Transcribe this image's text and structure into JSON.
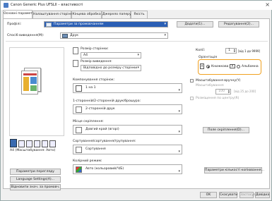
{
  "window": {
    "title": "Canon Generic Plus UFSLII – властивості",
    "close": "×"
  },
  "tabs": [
    {
      "label": "Основні параметри"
    },
    {
      "label": "Налаштування сторінки"
    },
    {
      "label": "Кінцева обробка"
    },
    {
      "label": "Джерело паперу"
    },
    {
      "label": "Якість"
    }
  ],
  "profile": {
    "label": "Профілі:",
    "value": "Параметри за промовчанням",
    "add_label": "Додати(1)...",
    "edit_label": "Редагування(2)..."
  },
  "output": {
    "label": "Спосіб виведення(M):",
    "value": "Друк"
  },
  "page_size": {
    "label": "Розмір сторінки:",
    "value": "A4"
  },
  "output_size": {
    "label": "Розмір виведення:",
    "value": "Відповідно до розміру сторінки"
  },
  "copies": {
    "label": "Копії:",
    "value": "1",
    "range": "[від 1 до 9999]"
  },
  "orientation": {
    "label": "Орієнтація",
    "portrait": "Книжкова",
    "landscape": "Альбомна"
  },
  "layout": {
    "label": "Компонування сторінок:",
    "value": "1 на 1"
  },
  "manual_scale": {
    "label": "Масштабування вручну(Y)",
    "scale_label": "Масштабування:",
    "value": "100",
    "range": "[від 25 до 200]"
  },
  "booklet_center": {
    "label": "Розміщення по центру(R)"
  },
  "duplex": {
    "label": "1-сторонній/2-сторонній друк/брошура:",
    "value": "2-сторонній друк"
  },
  "binding": {
    "label": "Місце скріплення:",
    "value": "Довгий край (вгорі)",
    "margin_button": "Поле скріплення(D)..."
  },
  "sorting": {
    "label": "Сортування/сортування/групування:",
    "value": "Сортування"
  },
  "color": {
    "label": "Колірний режим:",
    "value": "Авто (кольоровий/Ч/Б)",
    "settings_button": "Параметри кількості копіювання..."
  },
  "preview": {
    "caption": "A4 (Масштабування: Авто)"
  },
  "left_buttons": {
    "view_settings": "Параметри перегляду",
    "language": "Language Settings(A)...",
    "restore": "Відновити знач. за промовч."
  },
  "footer": {
    "ok": "OK",
    "cancel": "Скасувати",
    "apply": "Застосувати",
    "help": "Довідка"
  },
  "colors": {
    "accent": "#f0a020",
    "brand": "#4a7cc4"
  }
}
